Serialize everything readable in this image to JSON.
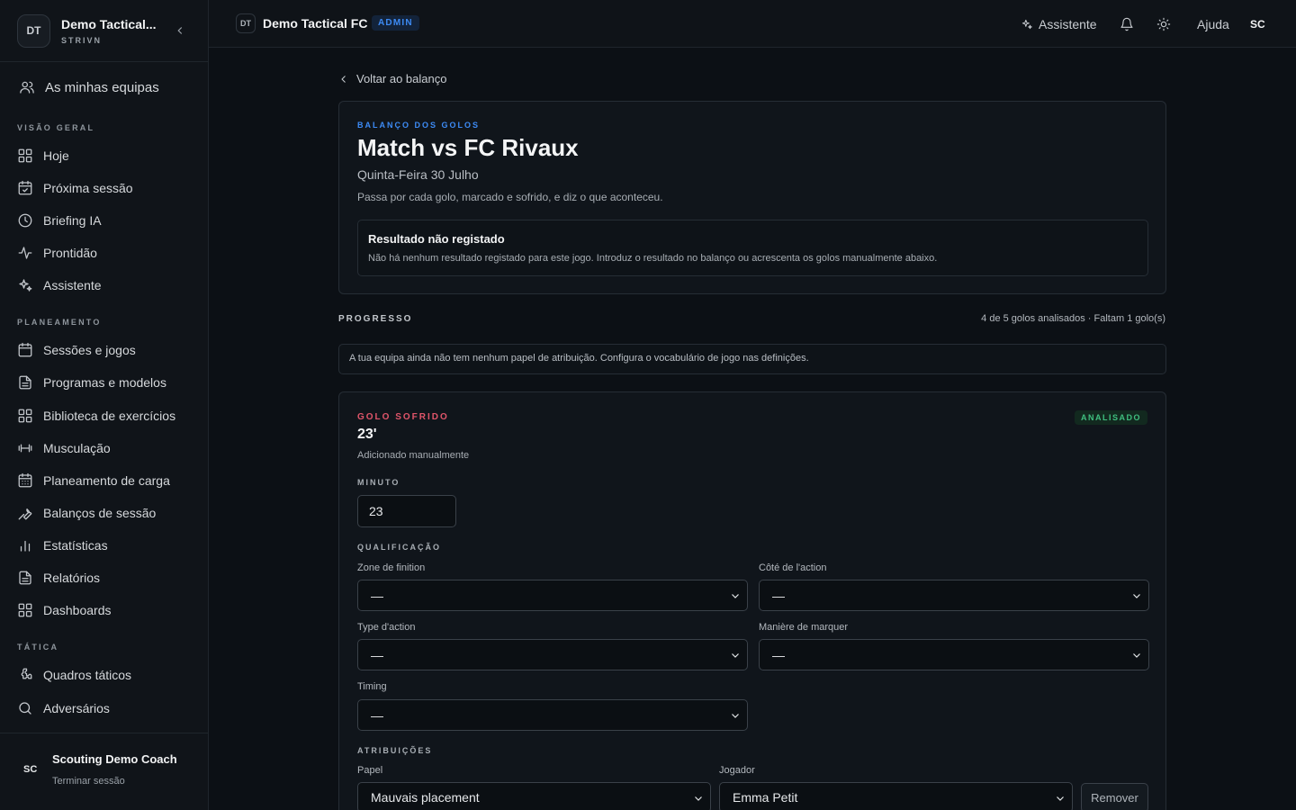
{
  "sidebar": {
    "logo_initials": "DT",
    "team_name": "Demo Tactical...",
    "brand": "STRIVN",
    "my_teams": "As minhas equipas",
    "sections": {
      "overview": "VISÃO GERAL",
      "planning": "PLANEAMENTO",
      "tactics": "TÁTICA"
    },
    "items": {
      "today": "Hoje",
      "next_session": "Próxima sessão",
      "briefing": "Briefing IA",
      "readiness": "Prontidão",
      "assistant": "Assistente",
      "sessions": "Sessões e jogos",
      "programs": "Programas e modelos",
      "exercises": "Biblioteca de exercícios",
      "strength": "Musculação",
      "load": "Planeamento de carga",
      "reviews": "Balanços de sessão",
      "stats": "Estatísticas",
      "reports": "Relatórios",
      "dashboards": "Dashboards",
      "boards": "Quadros táticos",
      "opponents": "Adversários"
    },
    "user": {
      "initials": "SC",
      "name": "Scouting Demo Coach",
      "logout": "Terminar sessão"
    }
  },
  "topbar": {
    "logo_initials": "DT",
    "team": "Demo Tactical FC",
    "role_badge": "ADMIN",
    "assistant": "Assistente",
    "help": "Ajuda",
    "user_initials": "SC"
  },
  "page": {
    "back_link": "Voltar ao balanço",
    "eyebrow": "BALANÇO DOS GOLOS",
    "title": "Match vs FC Rivaux",
    "date": "Quinta-Feira 30 Julho",
    "description": "Passa por cada golo, marcado e sofrido, e diz o que aconteceu.",
    "notice_title": "Resultado não registado",
    "notice_text": "Não há nenhum resultado registado para este jogo. Introduz o resultado no balanço ou acrescenta os golos manualmente abaixo.",
    "progress_label": "PROGRESSO",
    "progress_text": "4 de 5 golos analisados · Faltam 1 golo(s)",
    "info_text": "A tua equipa ainda não tem nenhum papel de atribuição. Configura o vocabulário de jogo nas definições."
  },
  "goal": {
    "type_label": "GOLO SOFRIDO",
    "minute_display": "23'",
    "source": "Adicionado manualmente",
    "status_badge": "ANALISADO",
    "minute_label": "MINUTO",
    "minute_value": "23",
    "qualification_label": "QUALIFICAÇÃO",
    "fields": {
      "zone_label": "Zone de finition",
      "zone_value": "—",
      "side_label": "Côté de l'action",
      "side_value": "—",
      "action_label": "Type d'action",
      "action_value": "—",
      "manner_label": "Manière de marquer",
      "manner_value": "—",
      "timing_label": "Timing",
      "timing_value": "—"
    },
    "attributions_label": "ATRIBUIÇÕES",
    "role_label": "Papel",
    "role_value": "Mauvais placement",
    "player_label": "Jogador",
    "player_value": "Emma Petit",
    "remove_button": "Remover"
  },
  "colors": {
    "accent_blue": "#3d8bf5",
    "conceded_red": "#e0556a",
    "analyzed_green": "#3fbf7f"
  }
}
